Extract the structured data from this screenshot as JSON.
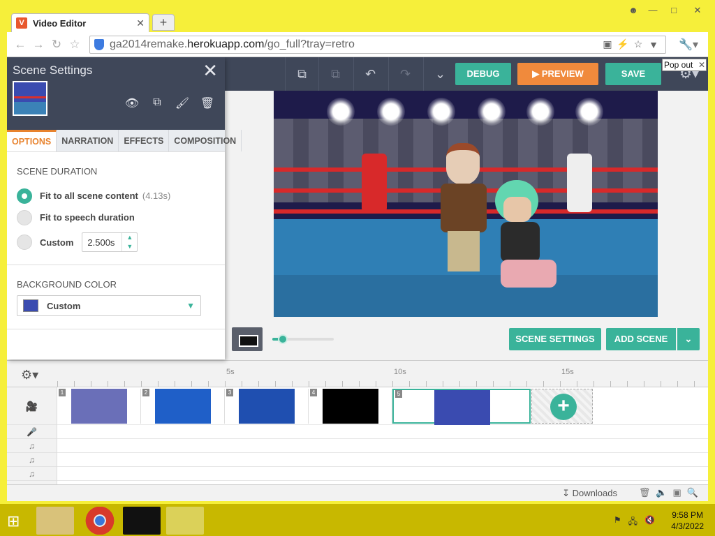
{
  "browser": {
    "tab_title": "Video Editor",
    "tab_icon_letter": "V",
    "url_prefix": "ga2014remake.",
    "url_domain": "herokuapp.com",
    "url_path": "/go_full?tray=retro"
  },
  "toolbar": {
    "debug_label": "DEBUG",
    "preview_label": "PREVIEW",
    "save_label": "SAVE",
    "popout_label": "Pop out"
  },
  "panel": {
    "title": "Scene Settings",
    "tabs": [
      "OPTIONS",
      "NARRATION",
      "EFFECTS",
      "COMPOSITION"
    ],
    "active_tab": "OPTIONS",
    "duration_label": "SCENE DURATION",
    "options": [
      {
        "label": "Fit to all scene content",
        "sub": "(4.13s)",
        "selected": true
      },
      {
        "label": "Fit to speech duration",
        "sub": "",
        "selected": false
      },
      {
        "label": "Custom",
        "sub": "",
        "selected": false
      }
    ],
    "custom_value": "2.500s",
    "bg_label": "BACKGROUND COLOR",
    "bg_value": "Custom"
  },
  "stage_bar": {
    "scene_settings_label": "SCENE SETTINGS",
    "add_scene_label": "ADD SCENE",
    "zoom_level": 0.12
  },
  "timeline": {
    "ticks": [
      "5s",
      "10s",
      "15s"
    ],
    "scenes": [
      {
        "num": "1",
        "color": "#6a6fb8"
      },
      {
        "num": "2",
        "color": "#1f5fc8"
      },
      {
        "num": "3",
        "color": "#1f4fb0"
      },
      {
        "num": "4",
        "color": "#000000"
      },
      {
        "num": "5",
        "color": "#3a4bb0"
      }
    ]
  },
  "downloads": {
    "label": "Downloads"
  },
  "clock": {
    "time": "9:58 PM",
    "date": "4/3/2022"
  },
  "colors": {
    "accent": "#3ab39a",
    "orange": "#f08a3c",
    "toolbar": "#3f4759"
  }
}
